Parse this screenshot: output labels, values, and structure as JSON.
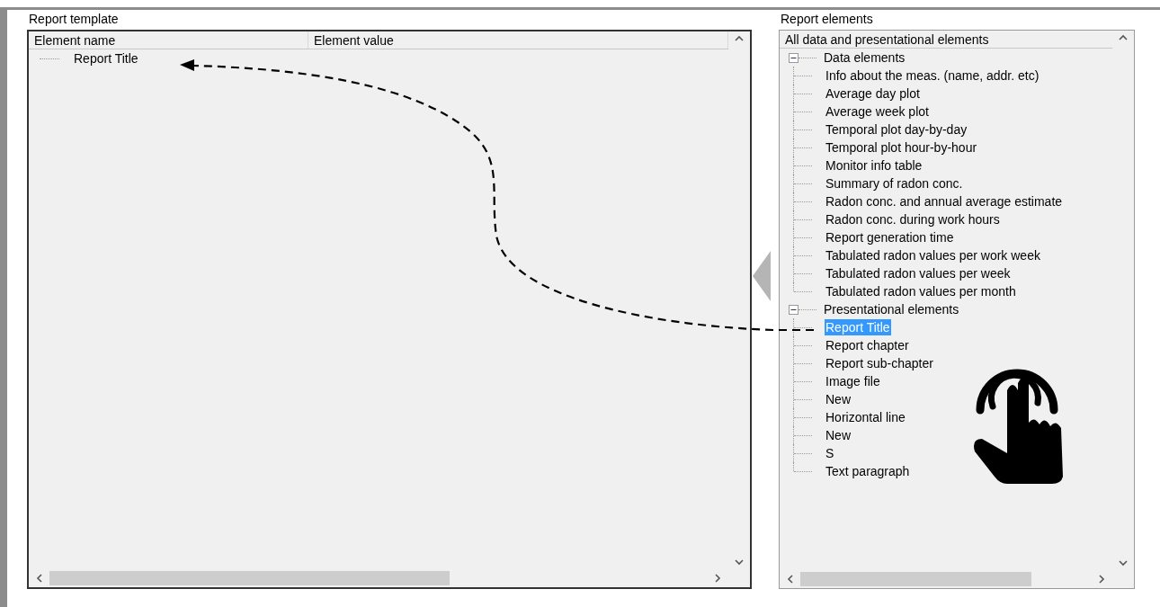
{
  "left_panel": {
    "title": "Report template",
    "columns": [
      "Element name",
      "Element value"
    ],
    "rows": [
      {
        "name": "Report Title"
      }
    ]
  },
  "right_panel": {
    "title": "Report elements",
    "header": "All data and presentational elements",
    "tree": [
      {
        "label": "Data elements",
        "expanded": true,
        "children": [
          {
            "label": "Info about the meas. (name, addr. etc)",
            "selected": false
          },
          {
            "label": "Average day plot",
            "selected": false
          },
          {
            "label": "Average week plot",
            "selected": false
          },
          {
            "label": "Temporal plot day-by-day",
            "selected": false
          },
          {
            "label": "Temporal plot hour-by-hour",
            "selected": false
          },
          {
            "label": "Monitor info table",
            "selected": false
          },
          {
            "label": "Summary of radon conc.",
            "selected": false
          },
          {
            "label": "Radon conc. and annual average estimate",
            "selected": false
          },
          {
            "label": "Radon conc. during work hours",
            "selected": false
          },
          {
            "label": "Report generation time",
            "selected": false
          },
          {
            "label": "Tabulated radon values per work week",
            "selected": false
          },
          {
            "label": "Tabulated radon values per week",
            "selected": false
          },
          {
            "label": "Tabulated radon values per month",
            "selected": false
          }
        ]
      },
      {
        "label": "Presentational elements",
        "expanded": true,
        "children": [
          {
            "label": "Report Title",
            "selected": true
          },
          {
            "label": "Report chapter",
            "selected": false
          },
          {
            "label": "Report sub-chapter",
            "selected": false
          },
          {
            "label": "Image file",
            "selected": false
          },
          {
            "label": "New",
            "selected": false
          },
          {
            "label": "Horizontal line",
            "selected": false
          },
          {
            "label": "New",
            "selected": false
          },
          {
            "label": "S",
            "selected": false
          },
          {
            "label": "Text paragraph",
            "selected": false
          }
        ]
      }
    ]
  }
}
